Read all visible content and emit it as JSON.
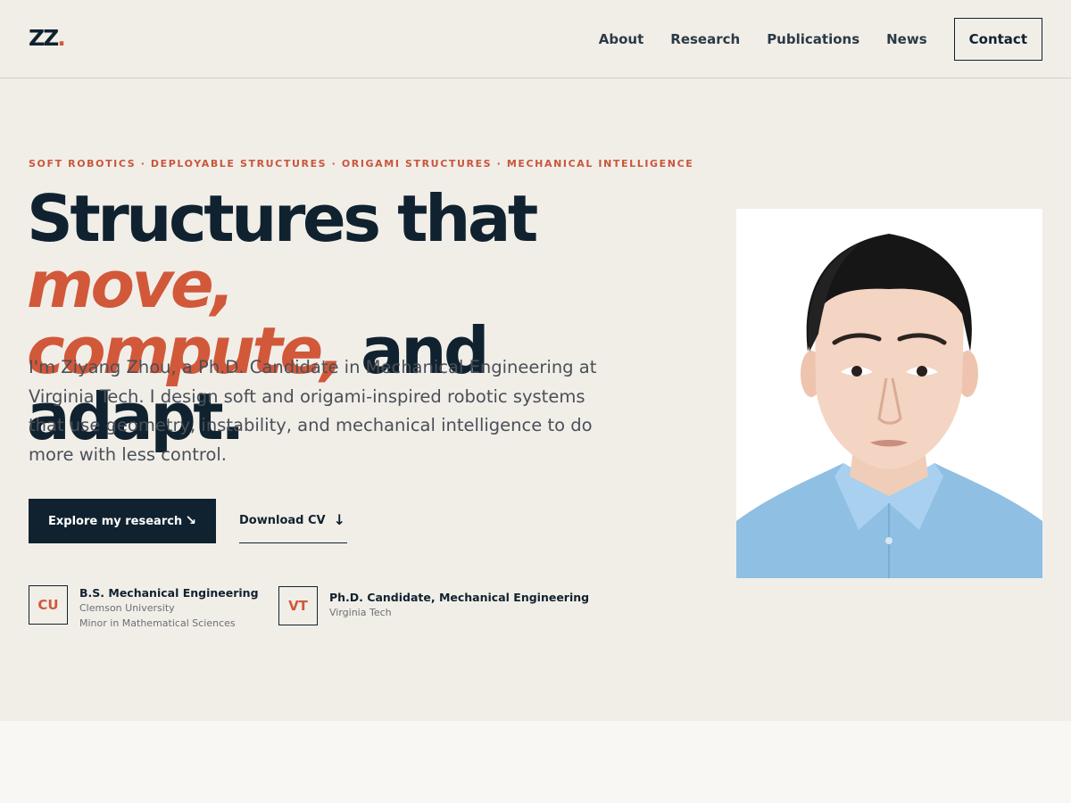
{
  "header": {
    "logo_text": "ZZ",
    "logo_dot": ".",
    "nav": [
      {
        "label": "About"
      },
      {
        "label": "Research"
      },
      {
        "label": "Publications"
      },
      {
        "label": "News"
      }
    ],
    "contact_label": "Contact"
  },
  "hero": {
    "eyebrow": "SOFT ROBOTICS · DEPLOYABLE STRUCTURES · ORIGAMI STRUCTURES · MECHANICAL INTELLIGENCE",
    "headline": {
      "part1": "Structures that ",
      "accent1": "move,",
      "accent2": "compute,",
      "part2": " and adapt."
    },
    "intro": "I'm Ziyang Zhou, a Ph.D. Candidate in Mechanical Engineering at Virginia Tech. I design soft and origami-inspired robotic systems that use geometry, instability, and mechanical intelligence to do more with less control.",
    "primary_button": {
      "label": "Explore my research",
      "icon": "arrow-down-right-icon"
    },
    "secondary_button": {
      "label": "Download CV",
      "icon": "arrow-down-icon"
    },
    "education": [
      {
        "badge": "CU",
        "degree": "B.S. Mechanical Engineering",
        "school": "Clemson University",
        "note": "Minor in Mathematical Sciences"
      },
      {
        "badge": "VT",
        "degree": "Ph.D. Candidate, Mechanical Engineering",
        "school": "Virginia Tech"
      }
    ]
  },
  "portrait": {
    "subject": "headshot of young man in light blue collared shirt"
  },
  "colors": {
    "background": "#f1eee8",
    "navy": "#10222f",
    "accent": "#d2583a",
    "lower_band": "#f8f7f3"
  }
}
